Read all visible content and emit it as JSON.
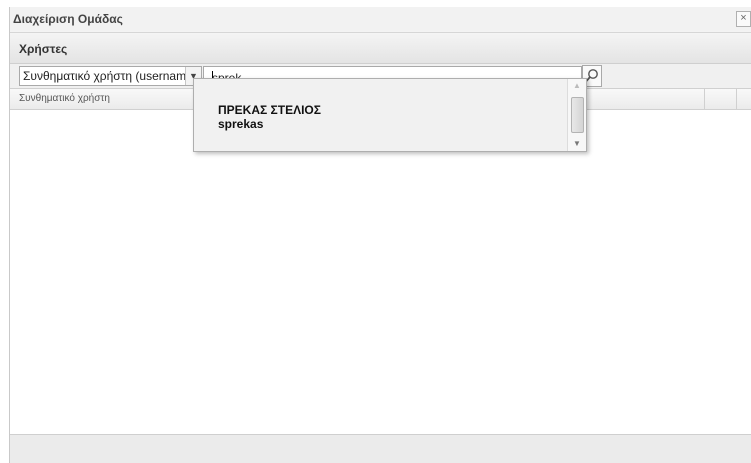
{
  "window": {
    "title": "Διαχείριση Ομάδας",
    "close_label": "×"
  },
  "panel": {
    "title": "Χρήστες"
  },
  "search": {
    "field_selected": "Συνθηματικό χρήστη (username)",
    "query": "sprek"
  },
  "grid": {
    "columns": [
      "Συνθηματικό χρήστη"
    ],
    "rows": []
  },
  "suggestions": [
    {
      "full_name": "ΠΡΕΚΑΣ ΣΤΕΛΙΟΣ",
      "username": "sprekas"
    }
  ],
  "icons": {
    "search": "magnifier-icon",
    "dropdown": "chevron-down-icon",
    "scroll_up": "arrow-up-icon",
    "scroll_down": "arrow-down-icon"
  }
}
